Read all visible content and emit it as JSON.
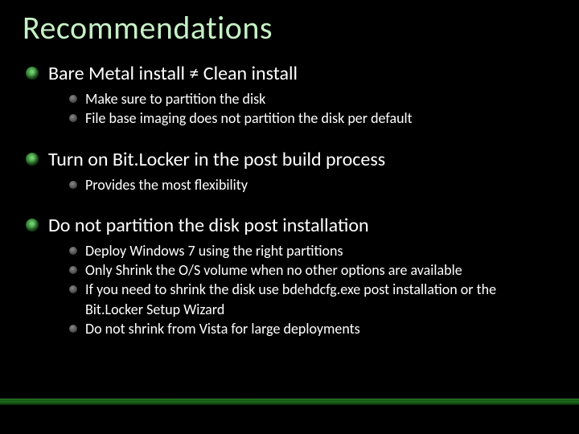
{
  "title": "Recommendations",
  "items": [
    {
      "text": "Bare Metal install ≠ Clean install",
      "sub": [
        "Make sure to partition the disk",
        "File base imaging does not partition the disk per default"
      ]
    },
    {
      "text": "Turn on Bit.Locker in the post build process",
      "sub": [
        "Provides the most flexibility"
      ]
    },
    {
      "text": "Do not partition the disk post installation",
      "sub": [
        "Deploy Windows 7 using the right partitions",
        "Only Shrink the O/S volume when no other options are available",
        "If you need to shrink the disk use bdehdcfg.exe post installation or the Bit.Locker Setup Wizard",
        "Do not shrink from Vista for large deployments"
      ]
    }
  ]
}
